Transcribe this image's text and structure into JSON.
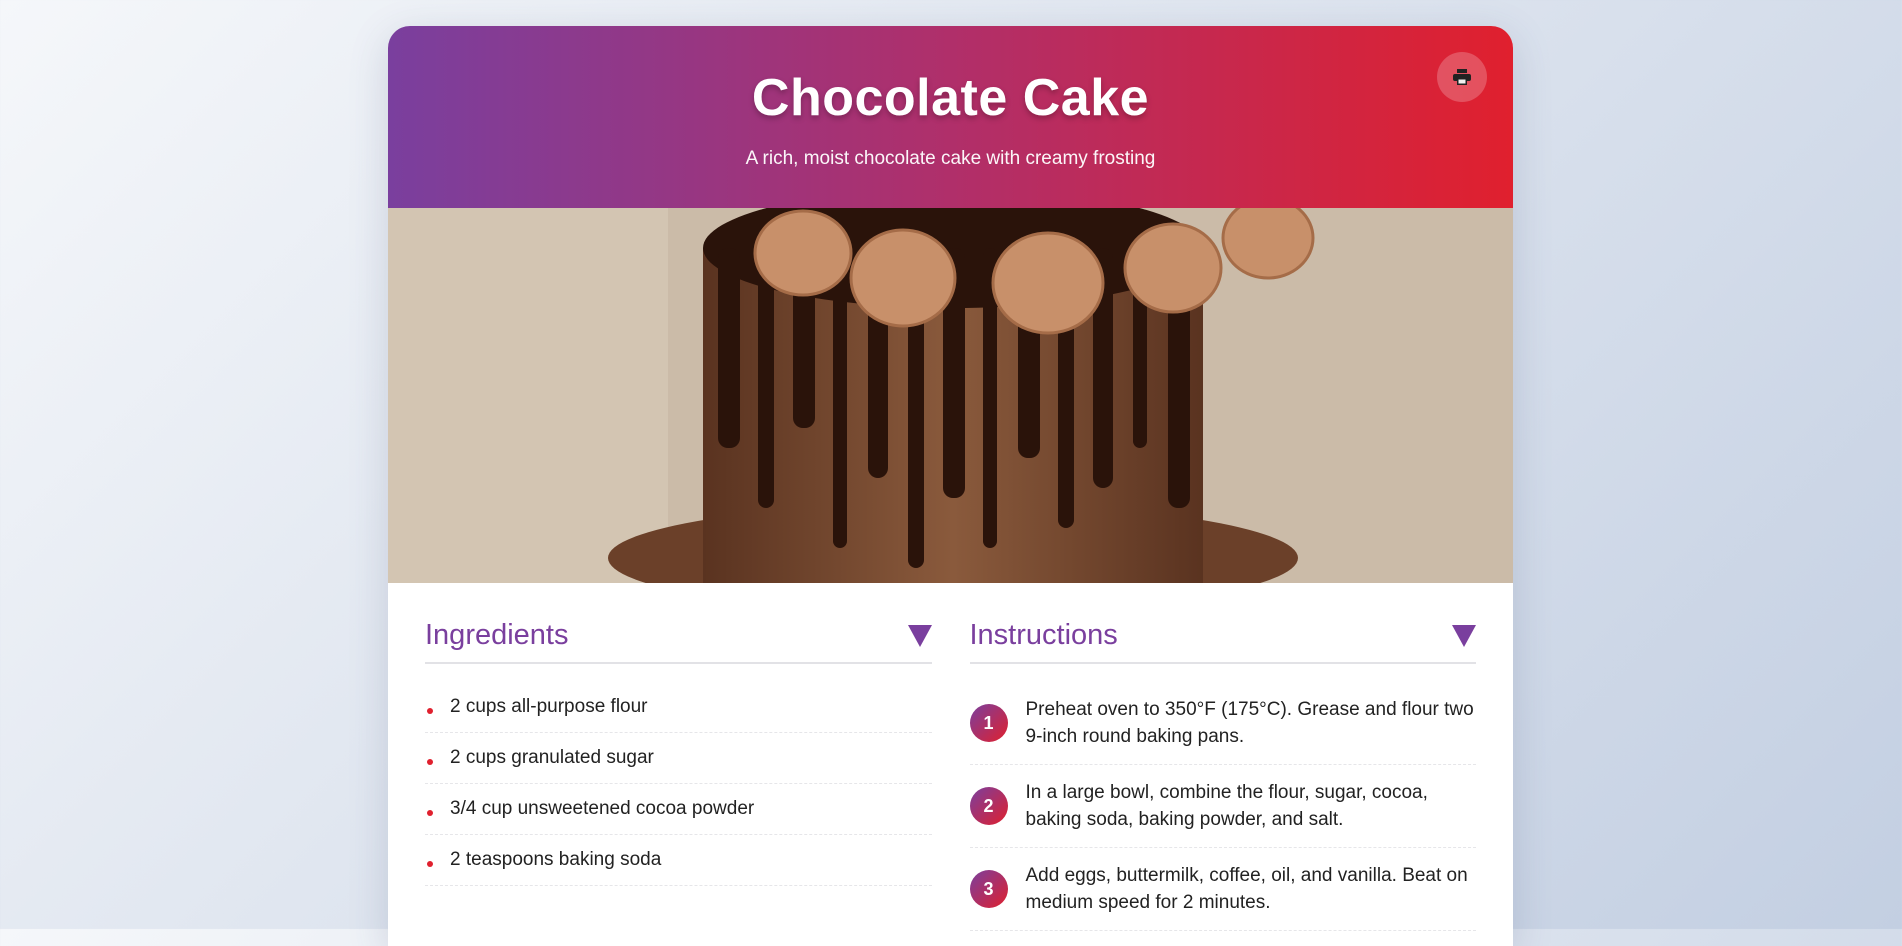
{
  "recipe": {
    "title": "Chocolate Cake",
    "subtitle": "A rich, moist chocolate cake with creamy frosting"
  },
  "icons": {
    "print": "printer-icon",
    "toggle": "triangle-down-icon"
  },
  "ingredients": {
    "heading": "Ingredients",
    "items": [
      "2 cups all-purpose flour",
      "2 cups granulated sugar",
      "3/4 cup unsweetened cocoa powder",
      "2 teaspoons baking soda"
    ]
  },
  "instructions": {
    "heading": "Instructions",
    "steps": [
      {
        "num": "1",
        "text": "Preheat oven to 350°F (175°C). Grease and flour two 9-inch round baking pans."
      },
      {
        "num": "2",
        "text": "In a large bowl, combine the flour, sugar, cocoa, baking soda, baking powder, and salt."
      },
      {
        "num": "3",
        "text": "Add eggs, buttermilk, coffee, oil, and vanilla. Beat on medium speed for 2 minutes."
      }
    ]
  },
  "colors": {
    "purple": "#7a3f9e",
    "red": "#e0202e"
  }
}
